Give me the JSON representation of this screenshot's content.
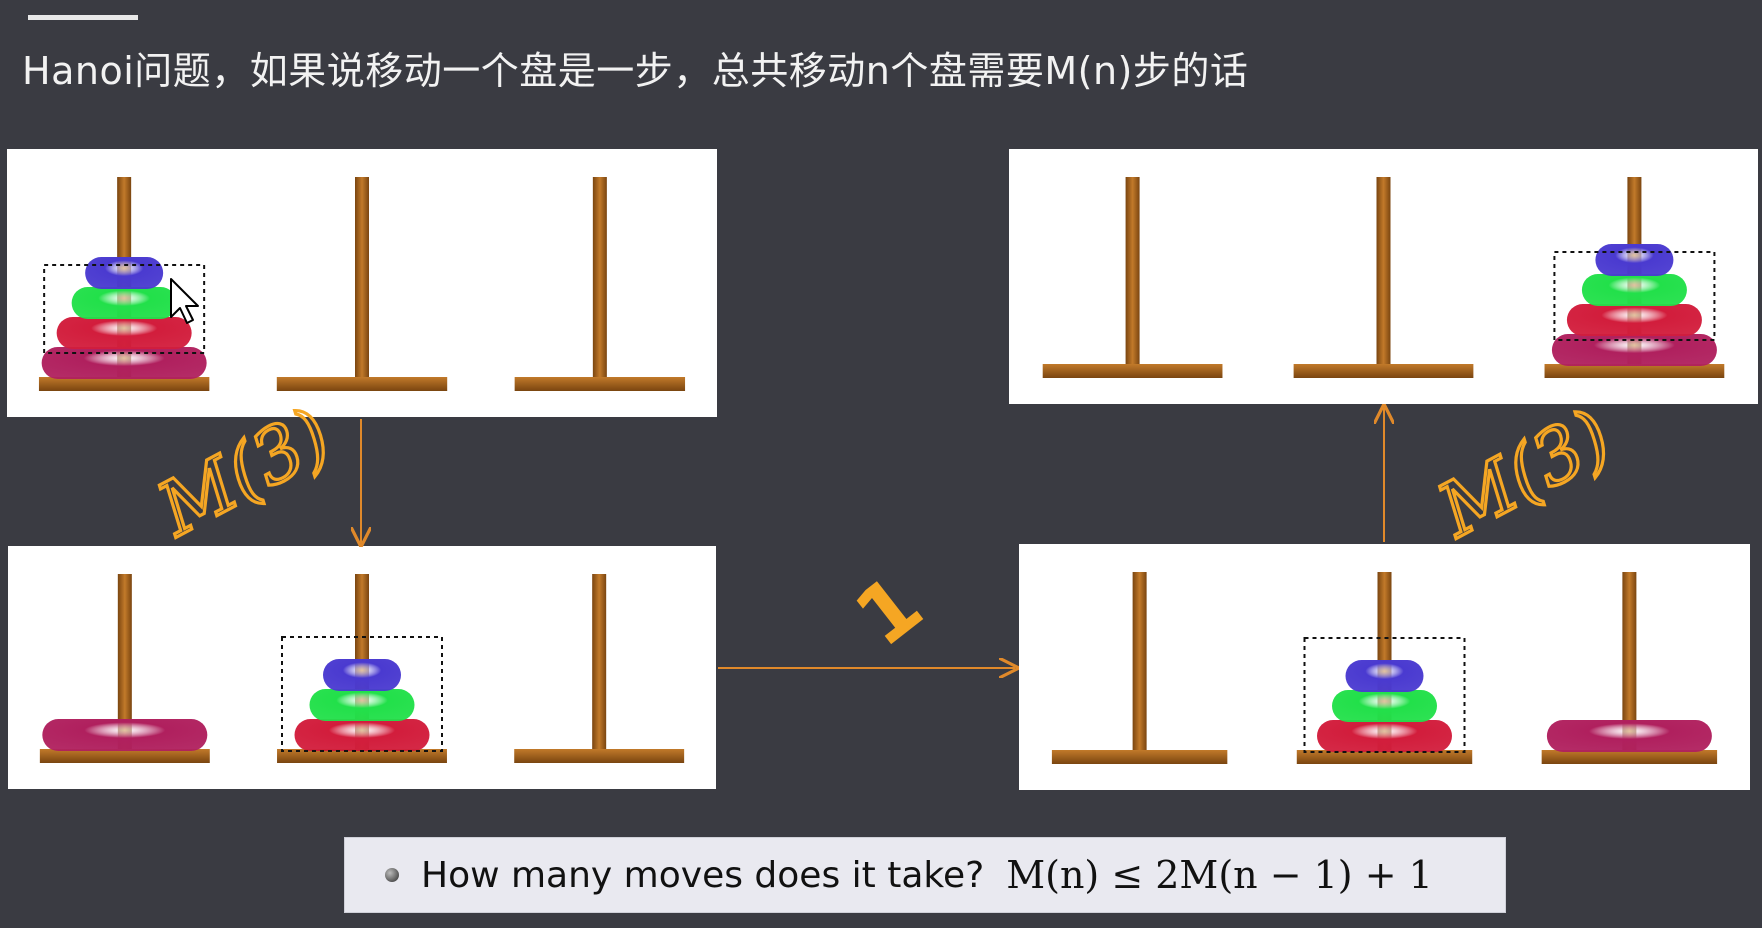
{
  "heading": "Hanoi问题，如果说移动一个盘是一步，总共移动n个盘需要M(n)步的话",
  "annotations": {
    "m3_left": "M(3)",
    "m3_right": "M(3)",
    "one_step": "1"
  },
  "bottom": {
    "question": "How many moves does it take?",
    "formula": "M(n) ≤ 2M(n − 1) + 1"
  },
  "colors": {
    "background": "#3a3b42",
    "rod": "#a8641c",
    "arrow": "#e0892a",
    "handwriting": "#f5a623",
    "disk_blue": "#4a3ad0",
    "disk_green": "#22e04a",
    "disk_red": "#d21d3c",
    "disk_magenta": "#b0205e"
  },
  "states": [
    {
      "name": "start",
      "pegs": [
        [
          "magenta",
          "red",
          "green",
          "blue"
        ],
        [],
        []
      ],
      "highlight_peg": 0
    },
    {
      "name": "after_first_M3",
      "pegs": [
        [
          "magenta"
        ],
        [
          "red",
          "green",
          "blue"
        ],
        []
      ],
      "highlight_peg": 1
    },
    {
      "name": "after_one_move",
      "pegs": [
        [],
        [
          "red",
          "green",
          "blue"
        ],
        [
          "magenta"
        ]
      ],
      "highlight_peg": 1
    },
    {
      "name": "final",
      "pegs": [
        [],
        [],
        [
          "magenta",
          "red",
          "green",
          "blue"
        ]
      ],
      "highlight_peg": 2
    }
  ]
}
